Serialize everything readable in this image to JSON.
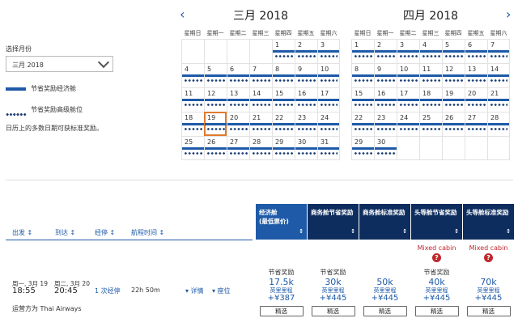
{
  "left": {
    "month_label": "选择月份",
    "month_value": "三月 2018",
    "legend_saver_economy": "节省奖励经济舱",
    "legend_saver_premium": "节省奖励高级舱位",
    "legend_note": "日历上的多数日期可获标准奖励。"
  },
  "calendars": [
    {
      "title": "三月 2018",
      "weekdays": [
        "星期日",
        "星期一",
        "星期二",
        "星期三",
        "星期四",
        "星期五",
        "星期六"
      ],
      "offset": 4,
      "days": 31
    },
    {
      "title": "四月 2018",
      "weekdays": [
        "星期日",
        "星期一",
        "星期二",
        "星期三",
        "星期四",
        "星期五",
        "星期六"
      ],
      "offset": 0,
      "days": 30
    }
  ],
  "selected_day": 19,
  "columns": {
    "depart": "出发 ↕",
    "arrive": "到达 ↕",
    "stops": "经停 ↕",
    "duration": "航程时间 ↕"
  },
  "cabins": [
    {
      "label": "经济舱",
      "sub": "(最低票价)",
      "sort": "↕"
    },
    {
      "label": "商务舱节省奖励",
      "sub": "",
      "sort": "↕"
    },
    {
      "label": "商务舱标准奖励",
      "sub": "",
      "sort": "↕"
    },
    {
      "label": "头等舱节省奖励",
      "sub": "",
      "sort": "↕"
    },
    {
      "label": "头等舱标准奖励",
      "sub": "",
      "sort": "↕"
    }
  ],
  "mixed_cabin": "Mixed cabin",
  "flight": {
    "depart_date": "周一, 3月 19",
    "depart_time": "18:55",
    "arrive_date": "周二, 3月 20",
    "arrive_time": "20:45",
    "stops": "1 次经停",
    "duration": "22h 50m",
    "details": "▾ 详情",
    "seats": "▾ 座位",
    "operator": "运营方为 Thai Airways"
  },
  "fares": [
    {
      "kind": "节省奖励",
      "miles": "17.5k",
      "unit": "英里里程",
      "tax": "+¥387",
      "btn": "精选"
    },
    {
      "kind": "节省奖励",
      "miles": "30k",
      "unit": "英里里程",
      "tax": "+¥445",
      "btn": "精选"
    },
    {
      "kind": "",
      "miles": "50k",
      "unit": "英里里程",
      "tax": "+¥445",
      "btn": "精选"
    },
    {
      "kind": "节省奖励",
      "miles": "40k",
      "unit": "英里里程",
      "tax": "+¥445",
      "btn": "精选"
    },
    {
      "kind": "",
      "miles": "70k",
      "unit": "英里里程",
      "tax": "+¥445",
      "btn": "精选"
    }
  ],
  "colors": {
    "accent": "#1e5aa8",
    "header_dark": "#0d2d5e",
    "mixed": "#c0272d",
    "selected": "#e07a2e"
  }
}
